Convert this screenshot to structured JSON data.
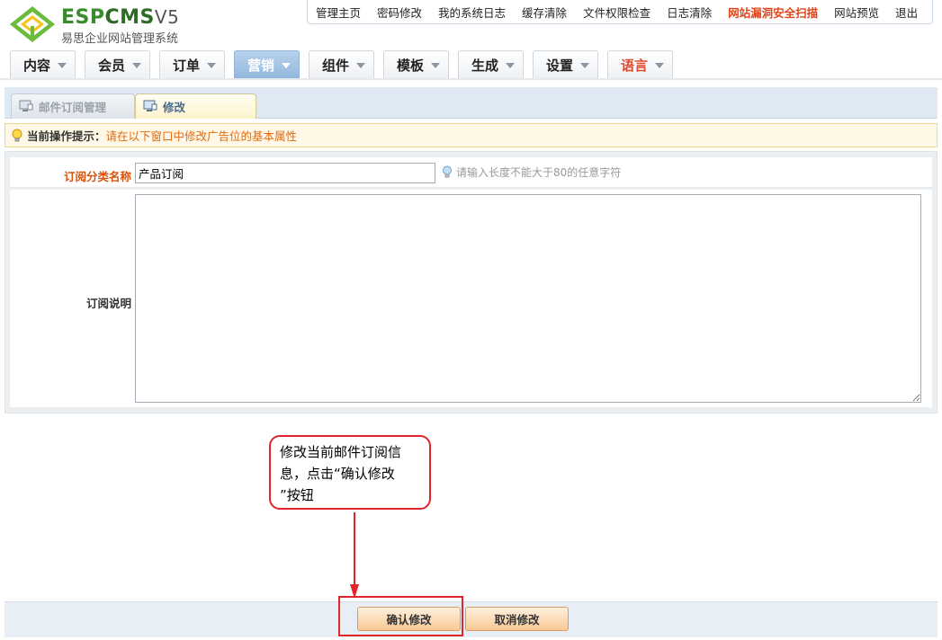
{
  "header": {
    "logo_esp": "ESP",
    "logo_cms": "CMS",
    "logo_version": "V5",
    "logo_subtitle": "易思企业网站管理系统"
  },
  "topbar": {
    "links": [
      "管理主页",
      "密码修改",
      "我的系统日志",
      "缓存清除",
      "文件权限检查",
      "日志清除",
      "网站漏洞安全扫描",
      "网站预览",
      "退出"
    ]
  },
  "mainnav": {
    "tabs": [
      "内容",
      "会员",
      "订单",
      "营销",
      "组件",
      "模板",
      "生成",
      "设置",
      "语言"
    ],
    "active": "营销"
  },
  "subtabs": {
    "manage": "邮件订阅管理",
    "edit": "修改"
  },
  "tip": {
    "label": "当前操作提示：",
    "text": "请在以下窗口中修改广告位的基本属性"
  },
  "form": {
    "name_label": "订阅分类名称",
    "name_value": "产品订阅",
    "name_hint": "请输入长度不能大于80的任意字符",
    "desc_label": "订阅说明",
    "desc_value": ""
  },
  "annotation": {
    "line1": "修改当前邮件订阅信",
    "line2": "息，点击“确认修改",
    "line3": "”按钮"
  },
  "buttons": {
    "confirm": "确认修改",
    "cancel": "取消修改"
  },
  "colors": {
    "accent_orange": "#e06a10",
    "label_orange": "#d9520c",
    "active_nav_blue": "#93b8de",
    "annotation_red": "#e3242b",
    "button_orange": "#f8c995"
  }
}
